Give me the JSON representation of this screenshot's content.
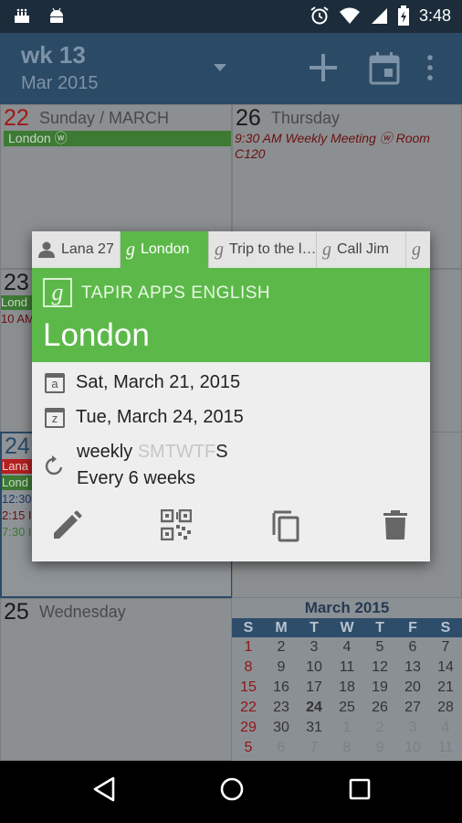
{
  "status_bar": {
    "time": "3:48"
  },
  "app_bar": {
    "week": "wk 13",
    "month": "Mar 2015"
  },
  "cells": {
    "c22": {
      "day": "22",
      "name": "Sunday / MARCH",
      "event": "London ⓦ"
    },
    "c26": {
      "day": "26",
      "name": "Thursday",
      "event_line1": "9:30 AM Weekly Meeting ⓦ Room",
      "event_line2": "C120"
    },
    "c23": {
      "day": "23",
      "stub1": "Lond",
      "stub2": "10 AM"
    },
    "c24": {
      "day": "24",
      "stub1": "Lana",
      "stub2": "Lond",
      "stub3": "12:30",
      "stub4": "2:15 I",
      "stub5": "7:30 I"
    },
    "c25": {
      "day": "25",
      "name": "Wednesday"
    }
  },
  "mini_calendar": {
    "title": "March 2015",
    "headers": [
      "S",
      "M",
      "T",
      "W",
      "T",
      "F",
      "S"
    ],
    "rows": [
      [
        "1",
        "2",
        "3",
        "4",
        "5",
        "6",
        "7"
      ],
      [
        "8",
        "9",
        "10",
        "11",
        "12",
        "13",
        "14"
      ],
      [
        "15",
        "16",
        "17",
        "18",
        "19",
        "20",
        "21"
      ],
      [
        "22",
        "23",
        "24",
        "25",
        "26",
        "27",
        "28"
      ],
      [
        "29",
        "30",
        "31",
        "1",
        "2",
        "3",
        "4"
      ],
      [
        "5",
        "6",
        "7",
        "8",
        "9",
        "10",
        "11"
      ]
    ]
  },
  "popup": {
    "tabs": [
      {
        "label": "Lana 27",
        "icon": "person-icon"
      },
      {
        "label": "London",
        "icon": "google-icon"
      },
      {
        "label": "Trip to the l…",
        "icon": "google-icon"
      },
      {
        "label": "Call Jim",
        "icon": "google-icon"
      }
    ],
    "account": "TAPIR APPS ENGLISH",
    "title": "London",
    "start_date": "Sat, March 21, 2015",
    "start_icon_letter": "a",
    "end_date": "Tue, March 24, 2015",
    "end_icon_letter": "z",
    "repeat_label": "weekly",
    "weekdays": [
      "S",
      "M",
      "T",
      "W",
      "T",
      "F",
      "S"
    ],
    "repeat_detail": "Every 6 weeks"
  },
  "colors": {
    "accent_green": "#5cb949",
    "app_bar": "#2b4a66",
    "status_bar": "#1c2c3a"
  }
}
